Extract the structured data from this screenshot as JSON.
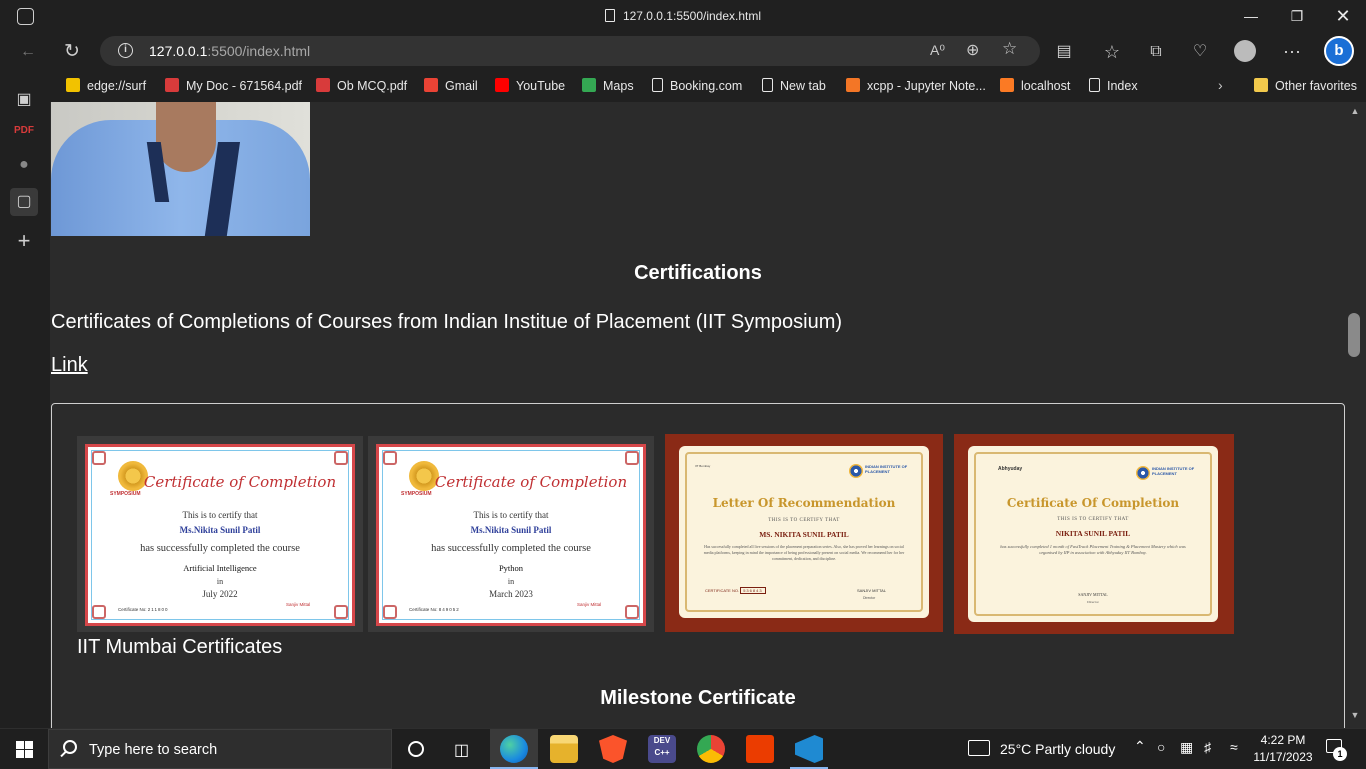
{
  "browser": {
    "tab_title": "127.0.0.1:5500/index.html",
    "url_host": "127.0.0.1",
    "url_rest": ":5500/index.html",
    "window_controls": [
      "minimize-icon",
      "restore-icon",
      "close-icon"
    ]
  },
  "favorites": [
    {
      "label": "edge://surf",
      "icon": "surf-icon",
      "color": "#f2c200"
    },
    {
      "label": "My Doc - 671564.pdf",
      "icon": "pdf-icon",
      "color": "#d83b3b"
    },
    {
      "label": "Ob MCQ.pdf",
      "icon": "pdf-icon",
      "color": "#d83b3b"
    },
    {
      "label": "Gmail",
      "icon": "gmail-icon",
      "color": "#ea4335"
    },
    {
      "label": "YouTube",
      "icon": "youtube-icon",
      "color": "#ff0000"
    },
    {
      "label": "Maps",
      "icon": "maps-icon",
      "color": "#34a853"
    },
    {
      "label": "Booking.com",
      "icon": "page-icon",
      "color": "#e8e8e8"
    },
    {
      "label": "New tab",
      "icon": "newtab-icon",
      "color": "#e8e8e8"
    },
    {
      "label": "xcpp - Jupyter Note...",
      "icon": "jupyter-icon",
      "color": "#f37626"
    },
    {
      "label": "localhost",
      "icon": "xampp-icon",
      "color": "#fb7a24"
    },
    {
      "label": "Index",
      "icon": "page-icon",
      "color": "#e8e8e8"
    }
  ],
  "other_favorites": "Other favorites",
  "page": {
    "certifications_heading": "Certifications",
    "certifications_desc": "Certificates of Completions of Courses from Indian Institue of Placement (IIT Symposium)",
    "link_label": "Link",
    "caption": "IIT Mumbai Certificates",
    "milestone_heading": "Milestone Certificate",
    "certificates": [
      {
        "title": "Certificate of Completion",
        "certify": "This is to certify that",
        "name": "Ms.Nikita Sunil Patil",
        "completed": "has successfully completed the course",
        "course": "Artificial Intelligence",
        "in": "in",
        "date": "July 2022",
        "cert_no_label": "Certificate No:",
        "cert_no": "211800",
        "signatory": "Sanjiv Mittal",
        "seal_label": "SYMPOSIUM"
      },
      {
        "title": "Certificate of Completion",
        "certify": "This is to certify that",
        "name": "Ms.Nikita Sunil Patil",
        "completed": "has successfully completed the course",
        "course": "Python",
        "in": "in",
        "date": "March 2023",
        "cert_no_label": "Certificate No:",
        "cert_no": "849052",
        "signatory": "Sanjiv Mittal",
        "seal_label": "SYMPOSIUM"
      },
      {
        "title": "Letter Of Recommendation",
        "certify": "THIS IS TO CERTIFY THAT",
        "name": "MS. NIKITA SUNIL PATIL",
        "body": "Has successfully completed all live sessions of the placement preparation series. Also, she has proved her learnings on social media platforms, keeping in mind the importance of being professionally present on social media. We recommend her for her commitment, dedication, and discipline.",
        "cert_no_label": "CERTIFICATE NO.",
        "cert_no": "536843",
        "signatory": "SANJIV MITTAL",
        "sign_role": "Director",
        "org_label": "INDIAN INSTITUTE OF PLACEMENT"
      },
      {
        "title": "Certificate Of Completion",
        "certify": "THIS IS TO CERTIFY THAT",
        "name": "NIKITA SUNIL PATIL",
        "body": "has successfully completed 1 month of FastTrack Placement Training & Placement Mastery which was organised by IIP in association with Abhyuday IIT Bombay.",
        "signatory": "SANJIV MITTAL",
        "sign_role": "Director",
        "org_label": "INDIAN INSTITUTE OF PLACEMENT",
        "partner_label": "Abhyuday"
      }
    ]
  },
  "taskbar": {
    "search_placeholder": "Type here to search",
    "weather": "25°C  Partly cloudy",
    "time": "4:22 PM",
    "date": "11/17/2023",
    "notification_count": "1"
  },
  "colors": {
    "accent": "#88b6f0",
    "cert_red": "#d6474a",
    "rec_frame": "#8a2a16",
    "gold": "#c8962c"
  }
}
